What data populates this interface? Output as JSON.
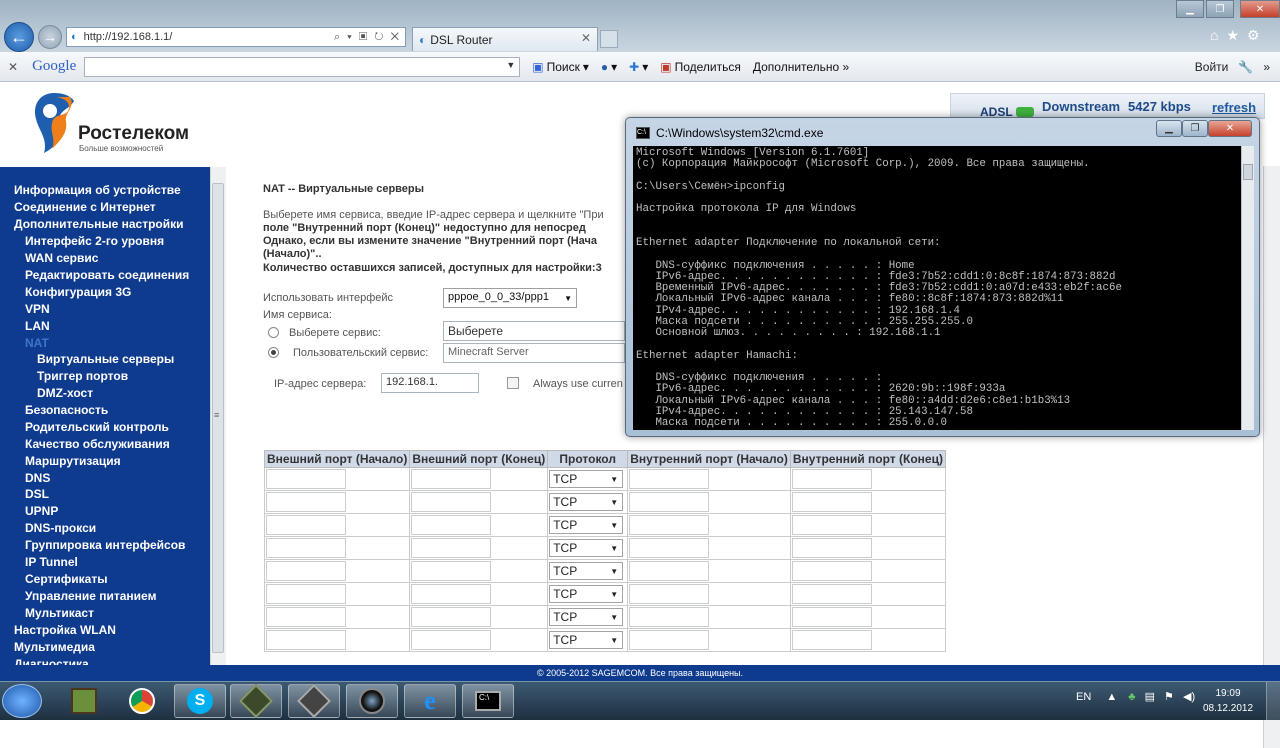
{
  "browser": {
    "url": "http://192.168.1.1/",
    "tab_title": "DSL Router",
    "google_label": "Google",
    "toolbar": [
      "Поиск",
      "Поделиться",
      "Дополнительно »"
    ],
    "signin": "Войти"
  },
  "router": {
    "brand": "Ростелеком",
    "slogan": "Больше возможностей",
    "adsl_label": "ADSL",
    "downstream_label": "Downstream",
    "downstream_value": "5427 kbps",
    "refresh": "refresh",
    "colors": {
      "nav_bg": "#0f3b8e",
      "header_bg": "#cfd9e8",
      "brand_orange": "#ef7f1a",
      "brand_blue": "#1d5fae"
    }
  },
  "sidebar": {
    "items": [
      {
        "label": "Информация об устройстве"
      },
      {
        "label": "Соединение с Интернет"
      },
      {
        "label": "Дополнительные настройки"
      },
      {
        "label": "Интерфейс 2-го уровня"
      },
      {
        "label": "WAN сервис"
      },
      {
        "label": "Редактировать соединения"
      },
      {
        "label": "Конфигурация 3G"
      },
      {
        "label": "VPN"
      },
      {
        "label": "LAN"
      },
      {
        "label": "NAT"
      },
      {
        "label": "Виртуальные серверы"
      },
      {
        "label": "Триггер портов"
      },
      {
        "label": "DMZ-хост"
      },
      {
        "label": "Безопасность"
      },
      {
        "label": "Родительский контроль"
      },
      {
        "label": "Качество обслуживания"
      },
      {
        "label": "Маршрутизация"
      },
      {
        "label": "DNS"
      },
      {
        "label": "DSL"
      },
      {
        "label": "UPNP"
      },
      {
        "label": "DNS-прокси"
      },
      {
        "label": "Группировка интерфейсов"
      },
      {
        "label": "IP Tunnel"
      },
      {
        "label": "Сертификаты"
      },
      {
        "label": "Управление питанием"
      },
      {
        "label": "Мультикаст"
      },
      {
        "label": "Настройка WLAN"
      },
      {
        "label": "Мультимедиа"
      },
      {
        "label": "Диагностика"
      }
    ]
  },
  "main": {
    "heading": "NAT -- Виртуальные серверы",
    "desc1": "Выберете имя сервиса, введие IP-адрес сервера и щелкните \"При",
    "desc2": "поле \"Внутренний порт (Конец)\" недоступно для непосред",
    "desc3": "Однако, если вы измените значение \"Внутренний порт (Нача",
    "desc4": "(Начало)\"..",
    "desc5": "Количество оставшихся записей, доступных для настройки:3",
    "use_iface_label": "Использовать интерфейс",
    "iface_value": "pppoe_0_0_33/ppp1",
    "service_name_label": "Имя сервиса:",
    "select_service_label": "Выберете сервис:",
    "select_service_value": "Выберете",
    "custom_service_label": "Пользовательский сервис:",
    "custom_service_value": "Minecraft Server",
    "server_ip_label": "IP-адрес сервера:",
    "server_ip_value": "192.168.1.",
    "always_label": "Always use curren",
    "table": {
      "headers": [
        "Внешний порт (Начало)",
        "Внешний порт (Конец)",
        "Протокол",
        "Внутренний порт (Начало)",
        "Внутренний порт (Конец)"
      ],
      "rows": [
        "TCP",
        "TCP",
        "TCP",
        "TCP",
        "TCP",
        "TCP",
        "TCP",
        "TCP"
      ]
    },
    "copyright": "© 2005-2012 SAGEMCOM. Все права защищены."
  },
  "cmd": {
    "title": "C:\\Windows\\system32\\cmd.exe",
    "lines": [
      "Microsoft Windows [Version 6.1.7601]",
      "(c) Корпорация Майкрософт (Microsoft Corp.), 2009. Все права защищены.",
      "",
      "C:\\Users\\Семён>ipconfig",
      "",
      "Настройка протокола IP для Windows",
      "",
      "",
      "Ethernet adapter Подключение по локальной сети:",
      "",
      "   DNS-суффикс подключения . . . . . : Home",
      "   IPv6-адрес. . . . . . . . . . . . : fde3:7b52:cdd1:0:8c8f:1874:873:882d",
      "   Временный IPv6-адрес. . . . . . . : fde3:7b52:cdd1:0:a07d:e433:eb2f:ac6e",
      "   Локальный IPv6-адрес канала . . . : fe80::8c8f:1874:873:882d%11",
      "   IPv4-адрес. . . . . . . . . . . . : 192.168.1.4",
      "   Маска подсети . . . . . . . . . . : 255.255.255.0",
      "   Основной шлюз. . . . . . . . . : 192.168.1.1",
      "",
      "Ethernet adapter Hamachi:",
      "",
      "   DNS-суффикс подключения . . . . . :",
      "   IPv6-адрес. . . . . . . . . . . . : 2620:9b::198f:933a",
      "   Локальный IPv6-адрес канала . . . : fe80::a4dd:d2e6:c8e1:b1b3%13",
      "   IPv4-адрес. . . . . . . . . . . . : 25.143.147.58",
      "   Маска подсети . . . . . . . . . . : 255.0.0.0"
    ]
  },
  "taskbar": {
    "lang": "EN",
    "time": "19:09",
    "date": "08.12.2012"
  }
}
